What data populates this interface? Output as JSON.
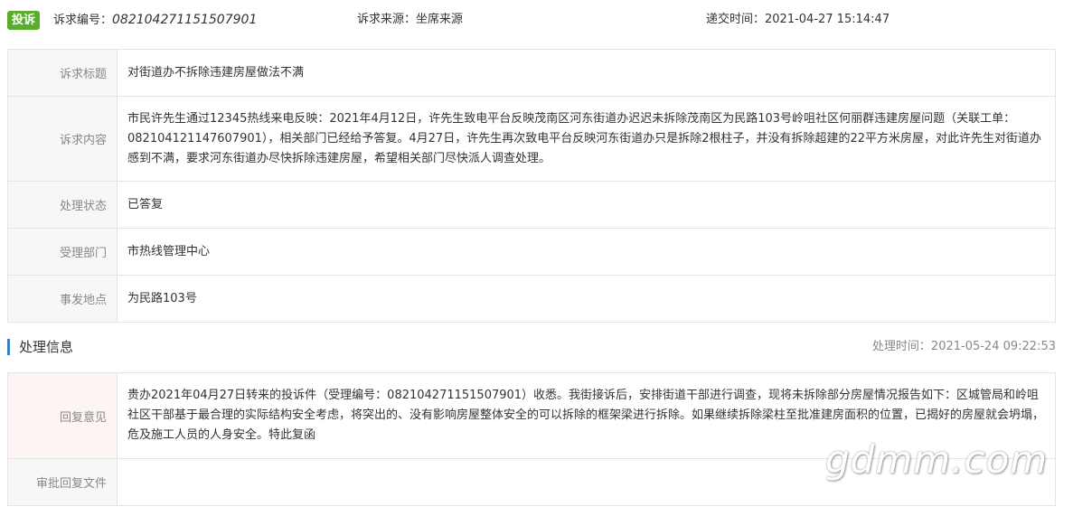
{
  "header": {
    "badge": "投诉",
    "number_label": "诉求编号：",
    "number_value": "082104271151507901",
    "source_label": "诉求来源：",
    "source_value": "坐席来源",
    "submit_label": "递交时间：",
    "submit_value": "2021-04-27 15:14:47"
  },
  "info": {
    "title_label": "诉求标题",
    "title_value": "对街道办不拆除违建房屋做法不满",
    "content_label": "诉求内容",
    "content_value": "市民许先生通过12345热线来电反映：2021年4月12日，许先生致电平台反映茂南区河东街道办迟迟未拆除茂南区为民路103号岭咀社区何丽群违建房屋问题（关联工单：082104121147607901），相关部门已经给予答复。4月27日，许先生再次致电平台反映河东街道办只是拆除2根柱子，并没有拆除超建的22平方米房屋，对此许先生对街道办感到不满，要求河东街道办尽快拆除违建房屋，希望相关部门尽快派人调查处理。",
    "status_label": "处理状态",
    "status_value": "已答复",
    "dept_label": "受理部门",
    "dept_value": "市热线管理中心",
    "place_label": "事发地点",
    "place_value": "为民路103号"
  },
  "handling": {
    "section_title": "处理信息",
    "time_label": "处理时间：",
    "time_value": "2021-05-24 09:22:53",
    "reply_label": "回复意见",
    "reply_value": "贵办2021年04月27日转来的投诉件（受理编号：082104271151507901）收悉。我街接诉后，安排街道干部进行调查，现将未拆除部分房屋情况报告如下：区城管局和岭咀社区干部基于最合理的实际结构安全考虑，将突出的、没有影响房屋整体安全的可以拆除的框架梁进行拆除。如果继续拆除梁柱至批准建房面积的位置，已揭好的房屋就会坍塌，危及施工人员的人身安全。特此复函",
    "file_label": "审批回复文件",
    "file_value": ""
  },
  "watermark": "gdmm.com",
  "colors": {
    "badge_green": "#5aac2c",
    "section_blue": "#3d7fc3",
    "status_green": "#5aac2c"
  }
}
